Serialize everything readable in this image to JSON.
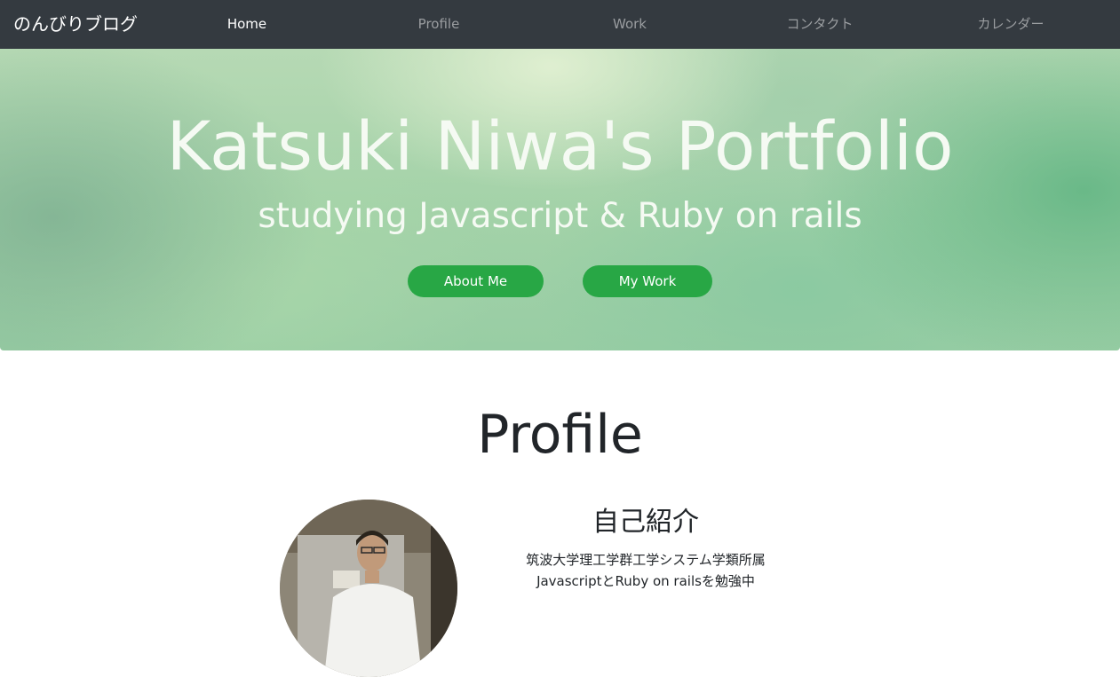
{
  "navbar": {
    "brand": "のんびりブログ",
    "items": [
      {
        "label": "Home",
        "active": true
      },
      {
        "label": "Profile",
        "active": false
      },
      {
        "label": "Work",
        "active": false
      },
      {
        "label": "コンタクト",
        "active": false
      },
      {
        "label": "カレンダー",
        "active": false
      }
    ]
  },
  "hero": {
    "title": "Katsuki Niwa's Portfolio",
    "subtitle": "studying Javascript & Ruby on rails",
    "buttons": {
      "about": "About Me",
      "work": "My Work"
    }
  },
  "profile": {
    "heading": "Profile",
    "intro_title": "自己紹介",
    "lines": [
      "筑波大学理工学群工学システム学類所属",
      "JavascriptとRuby on railsを勉強中"
    ]
  },
  "colors": {
    "navbar_bg": "#343a40",
    "button_bg": "#28a745",
    "nav_active": "#ffffff",
    "nav_inactive": "#9a9da0"
  }
}
